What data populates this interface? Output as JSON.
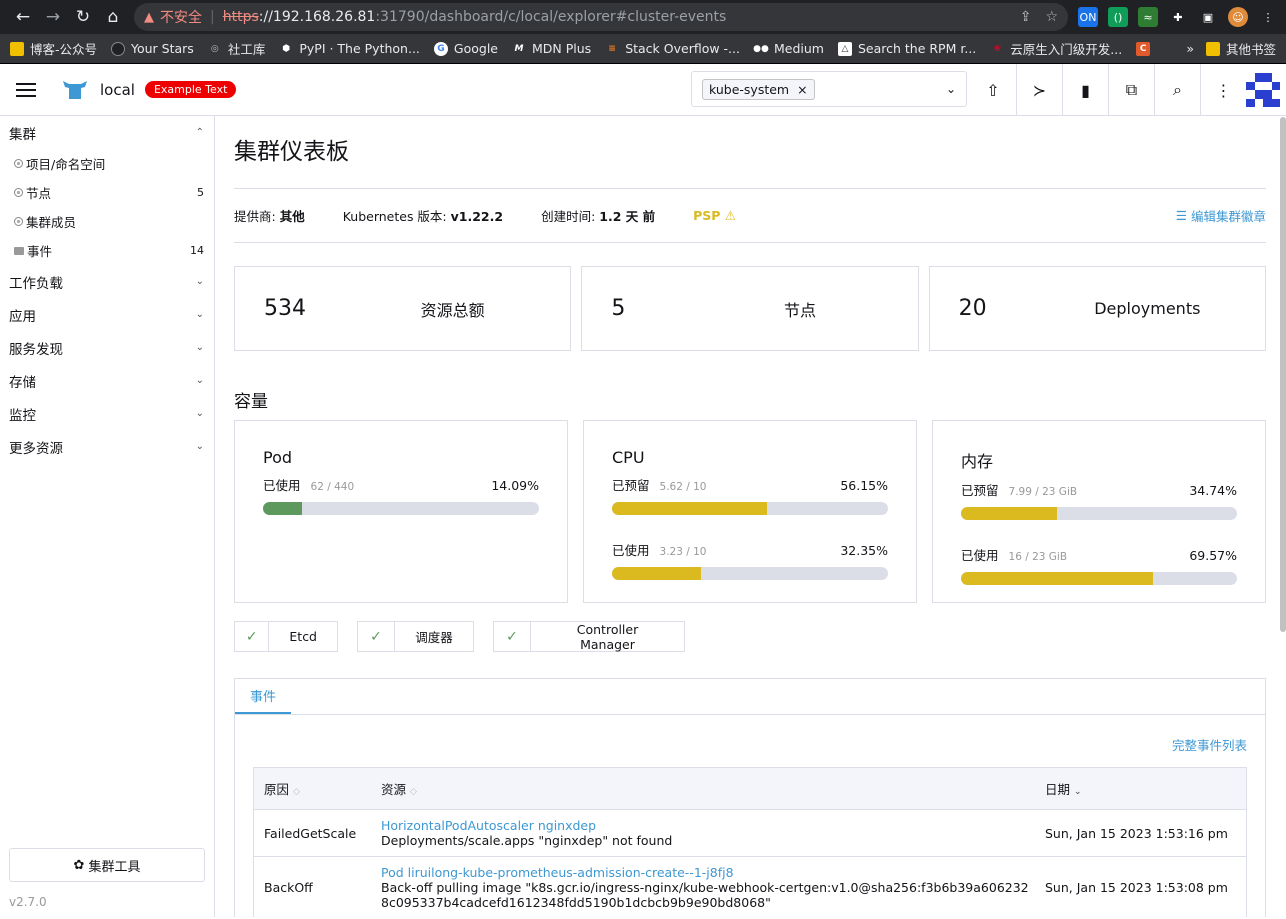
{
  "browser": {
    "insecure_label": "不安全",
    "url_scheme": "https",
    "url_host": "://192.168.26.81",
    "url_rest": ":31790/dashboard/c/local/explorer#cluster-events",
    "bookmarks": [
      {
        "label": "博客-公众号",
        "icon": "folder-icon",
        "color": "#f0c000"
      },
      {
        "label": "Your Stars",
        "icon": "github-icon",
        "color": "#202124"
      },
      {
        "label": "社工库",
        "icon": "globe-icon",
        "color": "#888888"
      },
      {
        "label": "PyPI · The Python...",
        "icon": "pypi-icon",
        "color": "#ffffff"
      },
      {
        "label": "Google",
        "icon": "google-icon",
        "color": "#ffffff"
      },
      {
        "label": "MDN Plus",
        "icon": "mdn-icon",
        "color": "#ffffff"
      },
      {
        "label": "Stack Overflow -...",
        "icon": "stackoverflow-icon",
        "color": "#f48024"
      },
      {
        "label": "Medium",
        "icon": "medium-icon",
        "color": "#ffffff"
      },
      {
        "label": "Search the RPM r...",
        "icon": "rpm-icon",
        "color": "#ffffff"
      },
      {
        "label": "云原生入门级开发...",
        "icon": "huawei-icon",
        "color": "#cf0a2c"
      }
    ],
    "other_bookmarks": "其他书签"
  },
  "header": {
    "cluster_name": "local",
    "badge": "Example Text",
    "namespace_chip": "kube-system",
    "namespace_chip_remove": "×"
  },
  "sidebar": {
    "cluster_group": "集群",
    "cluster_items": [
      {
        "label": "项目/命名空间",
        "count": "",
        "icon": "namespace-icon"
      },
      {
        "label": "节点",
        "count": "5",
        "icon": "node-icon"
      },
      {
        "label": "集群成员",
        "count": "",
        "icon": "members-icon"
      },
      {
        "label": "事件",
        "count": "14",
        "icon": "folder-icon"
      }
    ],
    "groups": [
      "工作负载",
      "应用",
      "服务发现",
      "存储",
      "监控",
      "更多资源"
    ],
    "tools_button": "集群工具",
    "version": "v2.7.0"
  },
  "main": {
    "title": "集群仪表板",
    "provider_label": "提供商: ",
    "provider_value": "其他",
    "k8s_label": "Kubernetes 版本: ",
    "k8s_value": "v1.22.2",
    "created_label": "创建时间: ",
    "created_value": "1.2 天 前",
    "psp": "PSP ⚠",
    "edit_badge": "编辑集群徽章",
    "stats": [
      {
        "value": "534",
        "label": "资源总额"
      },
      {
        "value": "5",
        "label": "节点"
      },
      {
        "value": "20",
        "label": "Deployments"
      }
    ],
    "capacity_title": "容量",
    "gauges": {
      "pod": {
        "title": "Pod",
        "rows": [
          {
            "label": "已使用",
            "sub": "62 / 440",
            "pct": "14.09%",
            "fraction": 0.1409,
            "color": "#5d995d"
          }
        ]
      },
      "cpu": {
        "title": "CPU",
        "rows": [
          {
            "label": "已预留",
            "sub": "5.62 / 10",
            "pct": "56.15%",
            "fraction": 0.5615,
            "color": "#daba1f"
          },
          {
            "label": "已使用",
            "sub": "3.23 / 10",
            "pct": "32.35%",
            "fraction": 0.3235,
            "color": "#daba1f"
          }
        ]
      },
      "mem": {
        "title": "内存",
        "rows": [
          {
            "label": "已预留",
            "sub": "7.99 / 23 GiB",
            "pct": "34.74%",
            "fraction": 0.3474,
            "color": "#daba1f"
          },
          {
            "label": "已使用",
            "sub": "16 / 23 GiB",
            "pct": "69.57%",
            "fraction": 0.6957,
            "color": "#daba1f"
          }
        ]
      }
    },
    "components": [
      "Etcd",
      "调度器",
      "Controller Manager"
    ],
    "events_tab": "事件",
    "full_events_link": "完整事件列表",
    "table_headers": [
      "原因",
      "资源",
      "日期"
    ],
    "events": [
      {
        "reason": "FailedGetScale",
        "resource_link": "HorizontalPodAutoscaler nginxdep",
        "message": "Deployments/scale.apps \"nginxdep\" not found",
        "date": "Sun, Jan 15 2023  1:53:16 pm"
      },
      {
        "reason": "BackOff",
        "resource_link": "Pod liruilong-kube-prometheus-admission-create--1-j8fj8",
        "message": "Back-off pulling image \"k8s.gcr.io/ingress-nginx/kube-webhook-certgen:v1.0@sha256:f3b6b39a6062328c095337b4cadcefd1612348fdd5190b1dcbcb9b9e90bd8068\"",
        "date": "Sun, Jan 15 2023  1:53:08 pm"
      }
    ]
  }
}
